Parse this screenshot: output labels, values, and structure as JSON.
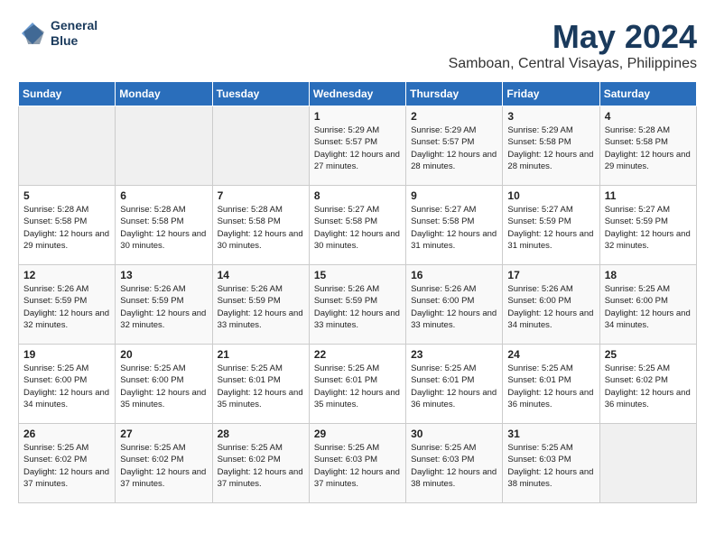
{
  "header": {
    "logo_line1": "General",
    "logo_line2": "Blue",
    "month": "May 2024",
    "location": "Samboan, Central Visayas, Philippines"
  },
  "days_of_week": [
    "Sunday",
    "Monday",
    "Tuesday",
    "Wednesday",
    "Thursday",
    "Friday",
    "Saturday"
  ],
  "weeks": [
    [
      {
        "day": "",
        "info": ""
      },
      {
        "day": "",
        "info": ""
      },
      {
        "day": "",
        "info": ""
      },
      {
        "day": "1",
        "info": "Sunrise: 5:29 AM\nSunset: 5:57 PM\nDaylight: 12 hours and 27 minutes."
      },
      {
        "day": "2",
        "info": "Sunrise: 5:29 AM\nSunset: 5:57 PM\nDaylight: 12 hours and 28 minutes."
      },
      {
        "day": "3",
        "info": "Sunrise: 5:29 AM\nSunset: 5:58 PM\nDaylight: 12 hours and 28 minutes."
      },
      {
        "day": "4",
        "info": "Sunrise: 5:28 AM\nSunset: 5:58 PM\nDaylight: 12 hours and 29 minutes."
      }
    ],
    [
      {
        "day": "5",
        "info": "Sunrise: 5:28 AM\nSunset: 5:58 PM\nDaylight: 12 hours and 29 minutes."
      },
      {
        "day": "6",
        "info": "Sunrise: 5:28 AM\nSunset: 5:58 PM\nDaylight: 12 hours and 30 minutes."
      },
      {
        "day": "7",
        "info": "Sunrise: 5:28 AM\nSunset: 5:58 PM\nDaylight: 12 hours and 30 minutes."
      },
      {
        "day": "8",
        "info": "Sunrise: 5:27 AM\nSunset: 5:58 PM\nDaylight: 12 hours and 30 minutes."
      },
      {
        "day": "9",
        "info": "Sunrise: 5:27 AM\nSunset: 5:58 PM\nDaylight: 12 hours and 31 minutes."
      },
      {
        "day": "10",
        "info": "Sunrise: 5:27 AM\nSunset: 5:59 PM\nDaylight: 12 hours and 31 minutes."
      },
      {
        "day": "11",
        "info": "Sunrise: 5:27 AM\nSunset: 5:59 PM\nDaylight: 12 hours and 32 minutes."
      }
    ],
    [
      {
        "day": "12",
        "info": "Sunrise: 5:26 AM\nSunset: 5:59 PM\nDaylight: 12 hours and 32 minutes."
      },
      {
        "day": "13",
        "info": "Sunrise: 5:26 AM\nSunset: 5:59 PM\nDaylight: 12 hours and 32 minutes."
      },
      {
        "day": "14",
        "info": "Sunrise: 5:26 AM\nSunset: 5:59 PM\nDaylight: 12 hours and 33 minutes."
      },
      {
        "day": "15",
        "info": "Sunrise: 5:26 AM\nSunset: 5:59 PM\nDaylight: 12 hours and 33 minutes."
      },
      {
        "day": "16",
        "info": "Sunrise: 5:26 AM\nSunset: 6:00 PM\nDaylight: 12 hours and 33 minutes."
      },
      {
        "day": "17",
        "info": "Sunrise: 5:26 AM\nSunset: 6:00 PM\nDaylight: 12 hours and 34 minutes."
      },
      {
        "day": "18",
        "info": "Sunrise: 5:25 AM\nSunset: 6:00 PM\nDaylight: 12 hours and 34 minutes."
      }
    ],
    [
      {
        "day": "19",
        "info": "Sunrise: 5:25 AM\nSunset: 6:00 PM\nDaylight: 12 hours and 34 minutes."
      },
      {
        "day": "20",
        "info": "Sunrise: 5:25 AM\nSunset: 6:00 PM\nDaylight: 12 hours and 35 minutes."
      },
      {
        "day": "21",
        "info": "Sunrise: 5:25 AM\nSunset: 6:01 PM\nDaylight: 12 hours and 35 minutes."
      },
      {
        "day": "22",
        "info": "Sunrise: 5:25 AM\nSunset: 6:01 PM\nDaylight: 12 hours and 35 minutes."
      },
      {
        "day": "23",
        "info": "Sunrise: 5:25 AM\nSunset: 6:01 PM\nDaylight: 12 hours and 36 minutes."
      },
      {
        "day": "24",
        "info": "Sunrise: 5:25 AM\nSunset: 6:01 PM\nDaylight: 12 hours and 36 minutes."
      },
      {
        "day": "25",
        "info": "Sunrise: 5:25 AM\nSunset: 6:02 PM\nDaylight: 12 hours and 36 minutes."
      }
    ],
    [
      {
        "day": "26",
        "info": "Sunrise: 5:25 AM\nSunset: 6:02 PM\nDaylight: 12 hours and 37 minutes."
      },
      {
        "day": "27",
        "info": "Sunrise: 5:25 AM\nSunset: 6:02 PM\nDaylight: 12 hours and 37 minutes."
      },
      {
        "day": "28",
        "info": "Sunrise: 5:25 AM\nSunset: 6:02 PM\nDaylight: 12 hours and 37 minutes."
      },
      {
        "day": "29",
        "info": "Sunrise: 5:25 AM\nSunset: 6:03 PM\nDaylight: 12 hours and 37 minutes."
      },
      {
        "day": "30",
        "info": "Sunrise: 5:25 AM\nSunset: 6:03 PM\nDaylight: 12 hours and 38 minutes."
      },
      {
        "day": "31",
        "info": "Sunrise: 5:25 AM\nSunset: 6:03 PM\nDaylight: 12 hours and 38 minutes."
      },
      {
        "day": "",
        "info": ""
      }
    ]
  ]
}
